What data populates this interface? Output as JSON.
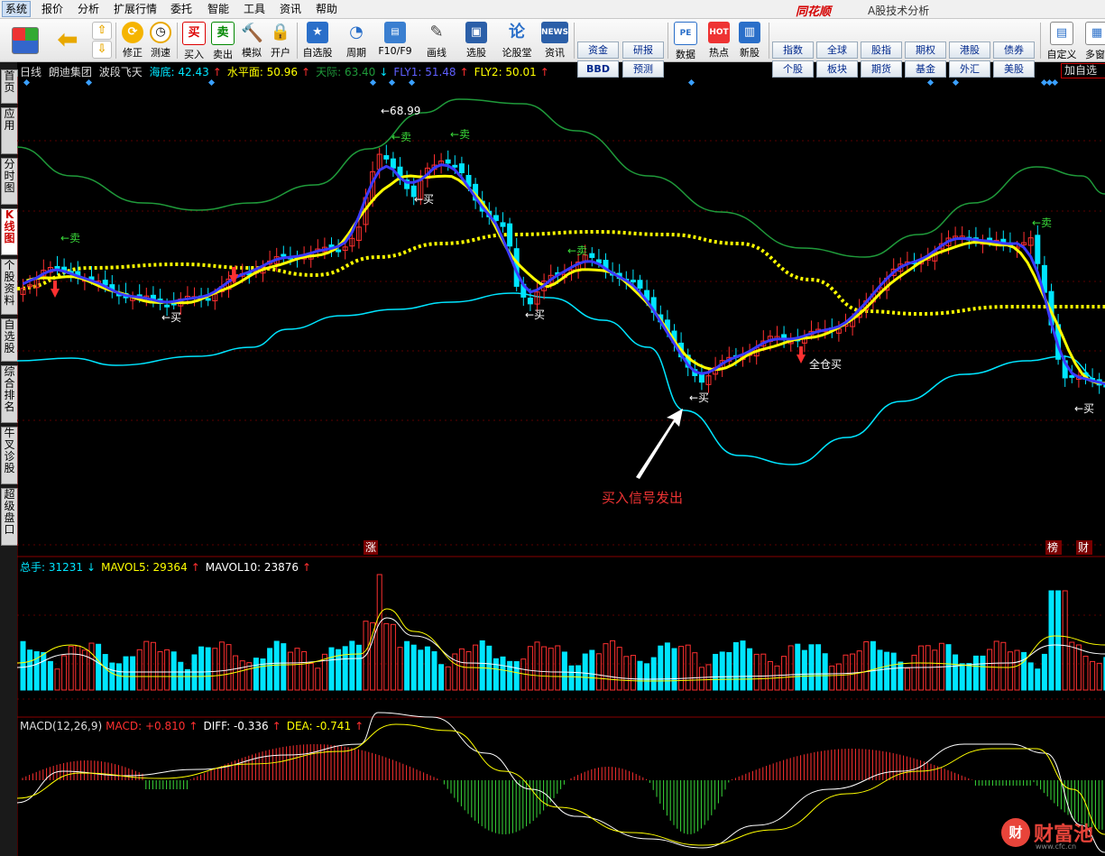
{
  "menu": [
    "系统",
    "报价",
    "分析",
    "扩展行情",
    "委托",
    "智能",
    "工具",
    "资讯",
    "帮助"
  ],
  "app": {
    "brand": "同花顺",
    "subtitle": "A股技术分析"
  },
  "toolbar": {
    "buttons": [
      "修正",
      "测速",
      "买入",
      "卖出",
      "模拟",
      "开户",
      "自选股",
      "周期",
      "F10/F9",
      "画线",
      "选股",
      "论股堂",
      "资讯",
      "数据",
      "热点",
      "新股",
      "自定义",
      "多窗"
    ],
    "buy_icon": "买",
    "sell_icon": "卖",
    "news_icon": "NEWS",
    "group1": [
      "资金",
      "研报",
      "BBD",
      "预测"
    ],
    "group2": [
      "指数",
      "全球",
      "股指",
      "期权",
      "港股",
      "债券",
      "个股",
      "板块",
      "期货",
      "基金",
      "外汇",
      "美股"
    ]
  },
  "side_tabs": [
    "首页",
    "应用",
    "分时图",
    "K线图",
    "个股资料",
    "自选股",
    "综合排名",
    "牛叉诊股",
    "超级盘口"
  ],
  "indicator": {
    "period": "日线",
    "stock": "朗迪集团",
    "name": "波段飞天",
    "items": [
      {
        "label": "海底:",
        "value": "42.43",
        "arrow": "↑",
        "color": "#00e5ff",
        "arrow_color": "#ff3030"
      },
      {
        "label": "水平面:",
        "value": "50.96",
        "arrow": "↑",
        "color": "#ffff00",
        "arrow_color": "#ff3030"
      },
      {
        "label": "天际:",
        "value": "63.40",
        "arrow": "↓",
        "color": "#1f9a3a",
        "arrow_color": "#00e5ff"
      },
      {
        "label": "FLY1:",
        "value": "51.48",
        "arrow": "↑",
        "color": "#5f5fff",
        "arrow_color": "#ff3030"
      },
      {
        "label": "FLY2:",
        "value": "50.01",
        "arrow": "↑",
        "color": "#ffff00",
        "arrow_color": "#ff3030"
      }
    ]
  },
  "add_watch": "加自选",
  "volume": {
    "items": [
      {
        "label": "总手:",
        "value": "31231",
        "arrow": "↓",
        "color": "#00e5ff",
        "arrow_color": "#00e5ff"
      },
      {
        "label": "MAVOL5:",
        "value": "29364",
        "arrow": "↑",
        "color": "#ffff00",
        "arrow_color": "#ff3030"
      },
      {
        "label": "MAVOL10:",
        "value": "23876",
        "arrow": "↑",
        "color": "#ffffff",
        "arrow_color": "#ff3030"
      }
    ]
  },
  "macd": {
    "params": "MACD(12,26,9)",
    "items": [
      {
        "label": "MACD:",
        "value": "+0.810",
        "arrow": "↑",
        "color": "#ff3030",
        "arrow_color": "#ff3030"
      },
      {
        "label": "DIFF:",
        "value": "-0.336",
        "arrow": "↑",
        "color": "#ffffff",
        "arrow_color": "#ff3030"
      },
      {
        "label": "DEA:",
        "value": "-0.741",
        "arrow": "↑",
        "color": "#ffff00",
        "arrow_color": "#ff3030"
      }
    ]
  },
  "chart_labels": {
    "high": "68.99",
    "buy": "买",
    "sell": "卖",
    "full_buy": "全仓买",
    "zhang": "涨",
    "bang": "榜",
    "cai": "财"
  },
  "annotation": "买入信号发出",
  "watermark": {
    "text": "财富池",
    "icon": "财",
    "url": "www.cfc.cn"
  },
  "colors": {
    "bg": "#000000",
    "up": "#ff3030",
    "down": "#00e5ff",
    "fly1": "#3a3aff",
    "fly2": "#ffff00",
    "sky": "#1f9a3a",
    "sea": "#00e5ff"
  }
}
